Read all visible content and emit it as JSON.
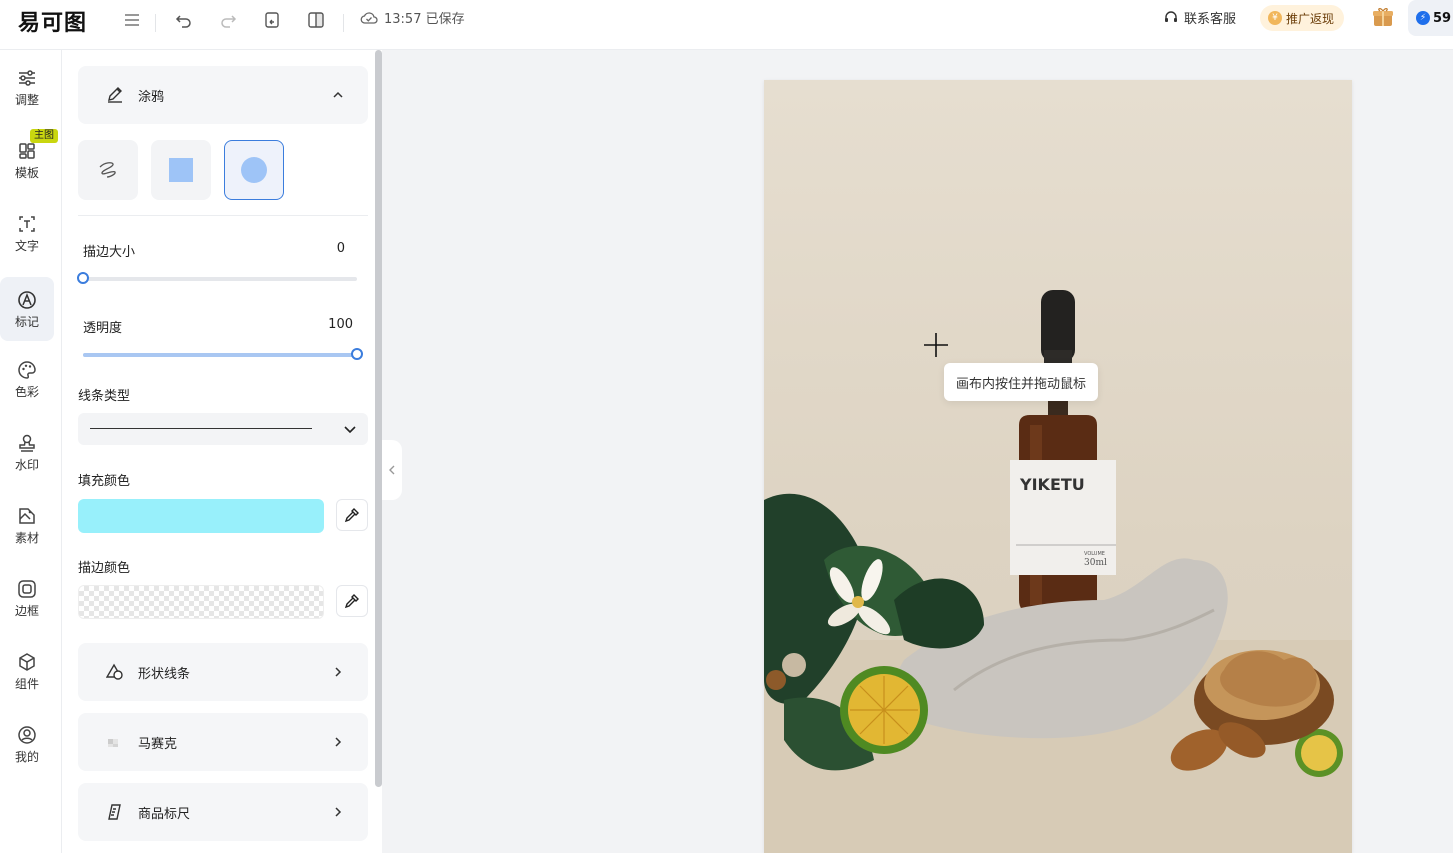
{
  "app": {
    "logo": "易可图"
  },
  "topbar": {
    "save_time": "13:57 已保存",
    "contact": "联系客服",
    "promo": "推广返现",
    "credits": "59"
  },
  "rail": {
    "items": [
      {
        "label": "调整",
        "icon": "sliders-icon"
      },
      {
        "label": "模板",
        "icon": "template-grid-icon"
      },
      {
        "label": "文字",
        "icon": "text-icon"
      },
      {
        "label": "标记",
        "icon": "mark-icon"
      },
      {
        "label": "色彩",
        "icon": "palette-icon"
      },
      {
        "label": "水印",
        "icon": "stamp-icon"
      },
      {
        "label": "素材",
        "icon": "material-icon"
      },
      {
        "label": "边框",
        "icon": "frame-icon"
      },
      {
        "label": "组件",
        "icon": "cube-icon"
      },
      {
        "label": "我的",
        "icon": "user-icon"
      }
    ],
    "badge": "主图"
  },
  "panel": {
    "doodle": {
      "title": "涂鸦"
    },
    "stroke_size": {
      "label": "描边大小",
      "value": "0",
      "fraction": 0
    },
    "opacity": {
      "label": "透明度",
      "value": "100",
      "fraction": 1
    },
    "line_type": {
      "label": "线条类型"
    },
    "fill_color": {
      "label": "填充颜色",
      "color": "#98f0fb"
    },
    "stroke_color": {
      "label": "描边颜色"
    },
    "shapes": {
      "title": "形状线条"
    },
    "mosaic": {
      "title": "马赛克"
    },
    "ruler": {
      "title": "商品标尺"
    }
  },
  "canvas": {
    "tooltip": "画布内按住并拖动鼠标",
    "product_label": "YIKETU",
    "product_volume": "30ml",
    "product_volume_small": "VOLUME"
  },
  "colors": {
    "accent": "#3b7ddd",
    "shape_fill": "#9ec4f7"
  }
}
